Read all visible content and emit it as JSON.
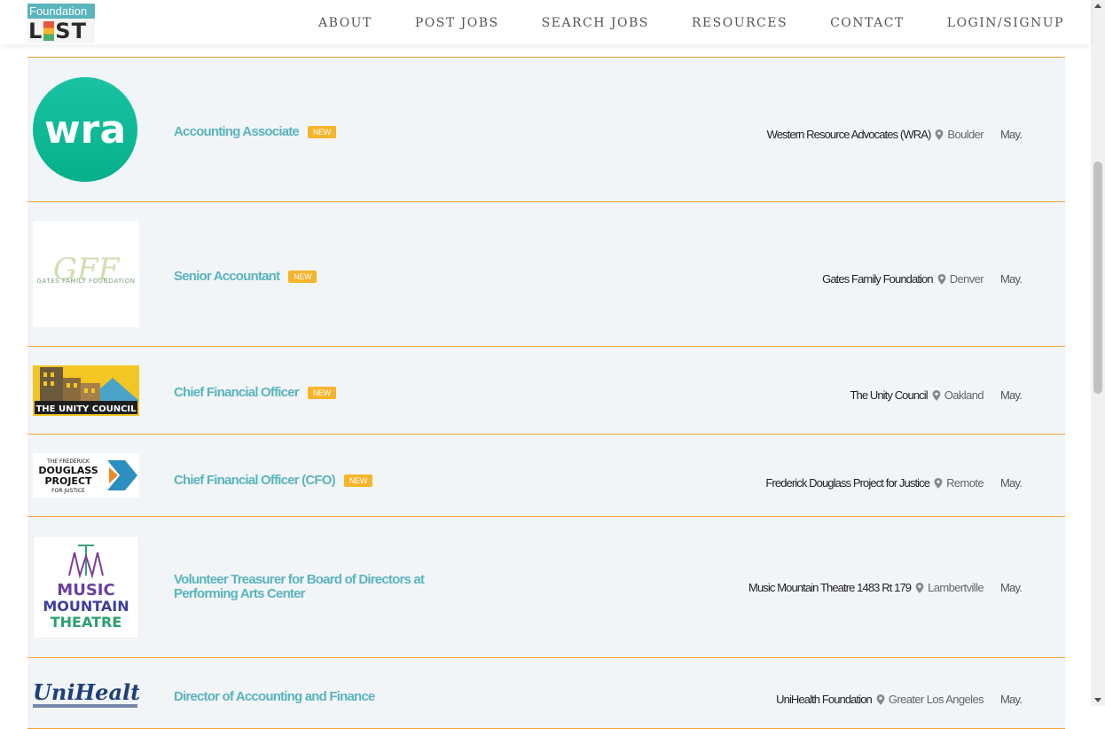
{
  "site": {
    "logo_top": "Foundation",
    "logo_bottom_a": "L",
    "logo_bottom_b": "ST"
  },
  "nav": [
    "ABOUT",
    "POST JOBS",
    "SEARCH JOBS",
    "RESOURCES",
    "CONTACT",
    "LOGIN/SIGNUP"
  ],
  "badge_label": "NEW",
  "jobs": [
    {
      "title": "Accounting Associate",
      "is_new": true,
      "org": "Western Resource Advocates (WRA)",
      "location": "Boulder",
      "date": "May.",
      "logo_text": "wra"
    },
    {
      "title": "Senior Accountant",
      "is_new": true,
      "org": "Gates Family Foundation",
      "location": "Denver",
      "date": "May.",
      "logo_text": "GATES FAMILY FOUNDATION"
    },
    {
      "title": "Chief Financial Officer",
      "is_new": true,
      "org": "The Unity Council",
      "location": "Oakland",
      "date": "May.",
      "logo_text": "THE UNITY COUNCIL"
    },
    {
      "title": "Chief Financial Officer (CFO)",
      "is_new": true,
      "org": "Frederick Douglass Project for Justice",
      "location": "Remote",
      "date": "May.",
      "logo_text": "THE FREDERICK DOUGLASS PROJECT FOR JUSTICE"
    },
    {
      "title": "Volunteer Treasurer for Board of Directors at Performing Arts Center",
      "is_new": false,
      "org": "Music Mountain Theatre 1483 Rt 179",
      "location": "Lambertville",
      "date": "May.",
      "logo_text": "MUSIC MOUNTAIN THEATRE"
    },
    {
      "title": "Director of Accounting and Finance",
      "is_new": false,
      "org": "UniHealth Foundation",
      "location": "Greater Los Angeles",
      "date": "May.",
      "logo_text": "UniHealth"
    }
  ],
  "icons": {
    "location": "map-pin-icon"
  },
  "colors": {
    "accent": "#5ab4bd",
    "badge": "#f6b42b",
    "divider": "#f0a538",
    "row_bg": "#f2f5f8"
  }
}
